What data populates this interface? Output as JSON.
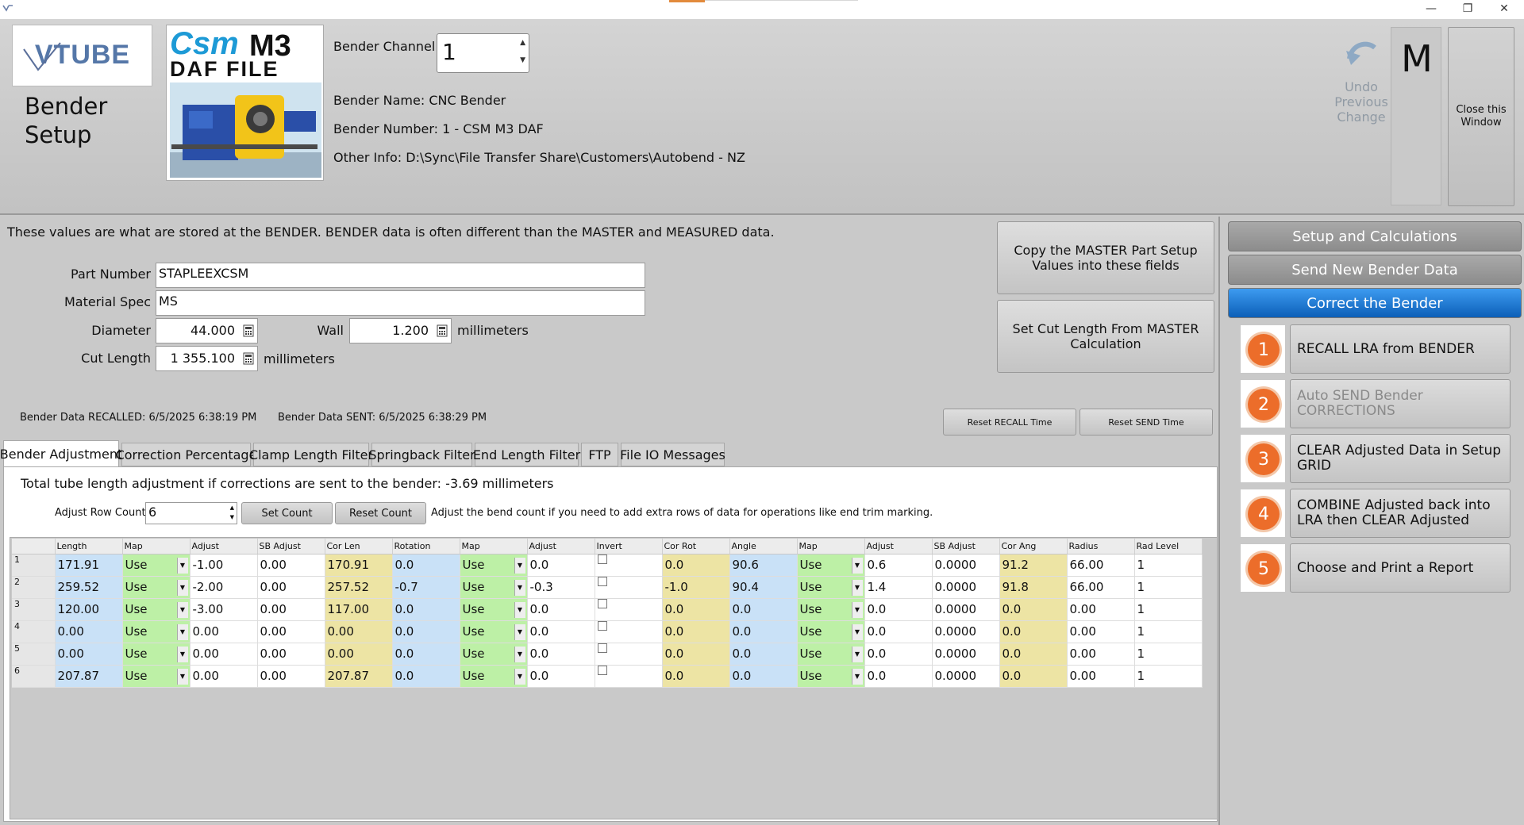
{
  "window": {
    "minimize_glyph": "—",
    "restore_glyph": "❐",
    "close_glyph": "✕"
  },
  "header": {
    "logo_text": "VTUBE",
    "title": "Bender Setup",
    "csm_logo_line1": "Csm",
    "csm_logo_line1b": "M3",
    "csm_logo_line2": "DAF FILE",
    "bender_channel_label": "Bender Channel:",
    "bender_channel_value": "1",
    "bender_name_label": "Bender Name:",
    "bender_name": "CNC Bender",
    "bender_number_label": "Bender Number:",
    "bender_number": "1 - CSM M3 DAF",
    "other_info_label": "Other Info:",
    "other_info": "D:\\Sync\\File Transfer Share\\Customers\\Autobend - NZ",
    "undo_label": "Undo Previous Change",
    "m_label": "M",
    "close_label": "Close this Window"
  },
  "main": {
    "info": "These values are what are stored at the BENDER.  BENDER data is often different than the MASTER and MEASURED data.",
    "part_number_label": "Part Number",
    "part_number": "STAPLEEXCSM",
    "material_spec_label": "Material Spec",
    "material_spec": "MS",
    "diameter_label": "Diameter",
    "diameter": "44.000",
    "wall_label": "Wall",
    "wall": "1.200",
    "units_1": "millimeters",
    "cut_length_label": "Cut Length",
    "cut_length": "1 355.100",
    "units_2": "millimeters",
    "copy_master_button": "Copy the MASTER Part Setup Values into these fields",
    "set_cut_length_button": "Set Cut Length From MASTER Calculation",
    "recalled_label": "Bender Data RECALLED:",
    "recalled_time": "6/5/2025 6:38:19 PM",
    "sent_label": "Bender Data SENT:",
    "sent_time": "6/5/2025 6:38:29 PM",
    "reset_recall_button": "Reset RECALL Time",
    "reset_send_button": "Reset SEND Time"
  },
  "tabs": [
    {
      "label": "Bender Adjustment"
    },
    {
      "label": "Correction Percentage"
    },
    {
      "label": "Clamp Length Filter"
    },
    {
      "label": "Springback Filter"
    },
    {
      "label": "End Length Filter"
    },
    {
      "label": "FTP"
    },
    {
      "label": "File IO Messages"
    }
  ],
  "adjust": {
    "total_label": "Total tube length adjustment if corrections are sent to the bender:",
    "total_value": "-3.69",
    "total_units": "millimeters",
    "row_count_label": "Adjust Row Count:",
    "row_count": "6",
    "set_count_button": "Set Count",
    "reset_count_button": "Reset Count",
    "hint": "Adjust the bend count if you need to add extra rows of data for operations like end trim marking."
  },
  "grid": {
    "columns": [
      "Length",
      "Map",
      "Adjust",
      "SB Adjust",
      "Cor Len",
      "Rotation",
      "Map",
      "Adjust",
      "Invert",
      "Cor Rot",
      "Angle",
      "Map",
      "Adjust",
      "SB Adjust",
      "Cor Ang",
      "Radius",
      "Rad Level"
    ],
    "rows": [
      [
        "1",
        "171.91",
        "Use",
        "-1.00",
        "0.00",
        "170.91",
        "0.0",
        "Use",
        "0.0",
        "",
        "0.0",
        "90.6",
        "Use",
        "0.6",
        "0.0000",
        "91.2",
        "66.00",
        "1"
      ],
      [
        "2",
        "259.52",
        "Use",
        "-2.00",
        "0.00",
        "257.52",
        "-0.7",
        "Use",
        "-0.3",
        "",
        "-1.0",
        "90.4",
        "Use",
        "1.4",
        "0.0000",
        "91.8",
        "66.00",
        "1"
      ],
      [
        "3",
        "120.00",
        "Use",
        "-3.00",
        "0.00",
        "117.00",
        "0.0",
        "Use",
        "0.0",
        "",
        "0.0",
        "0.0",
        "Use",
        "0.0",
        "0.0000",
        "0.0",
        "0.00",
        "1"
      ],
      [
        "4",
        "0.00",
        "Use",
        "0.00",
        "0.00",
        "0.00",
        "0.0",
        "Use",
        "0.0",
        "",
        "0.0",
        "0.0",
        "Use",
        "0.0",
        "0.0000",
        "0.0",
        "0.00",
        "1"
      ],
      [
        "5",
        "0.00",
        "Use",
        "0.00",
        "0.00",
        "0.00",
        "0.0",
        "Use",
        "0.0",
        "",
        "0.0",
        "0.0",
        "Use",
        "0.0",
        "0.0000",
        "0.0",
        "0.00",
        "1"
      ],
      [
        "6",
        "207.87",
        "Use",
        "0.00",
        "0.00",
        "207.87",
        "0.0",
        "Use",
        "0.0",
        "",
        "0.0",
        "0.0",
        "Use",
        "0.0",
        "0.0000",
        "0.0",
        "0.00",
        "1"
      ]
    ]
  },
  "side": {
    "nav": [
      {
        "label": "Setup and Calculations",
        "active": false
      },
      {
        "label": "Send New Bender Data",
        "active": false
      },
      {
        "label": "Correct the Bender",
        "active": true
      }
    ],
    "steps": [
      {
        "num": "1",
        "label": "RECALL LRA from BENDER",
        "disabled": false
      },
      {
        "num": "2",
        "label": "Auto SEND Bender CORRECTIONS",
        "disabled": true
      },
      {
        "num": "3",
        "label": "CLEAR Adjusted Data in Setup GRID",
        "disabled": false
      },
      {
        "num": "4",
        "label": "COMBINE Adjusted back into LRA then CLEAR Adjusted",
        "disabled": false
      },
      {
        "num": "5",
        "label": "Choose and Print a Report",
        "disabled": false
      }
    ]
  },
  "colors": {
    "accent_blue": "#0c5fb8",
    "step_orange": "#ec6d2a",
    "cell_blue": "#c9e1f7",
    "cell_green": "#bdf0a6",
    "cell_yellow": "#ede4a4"
  }
}
